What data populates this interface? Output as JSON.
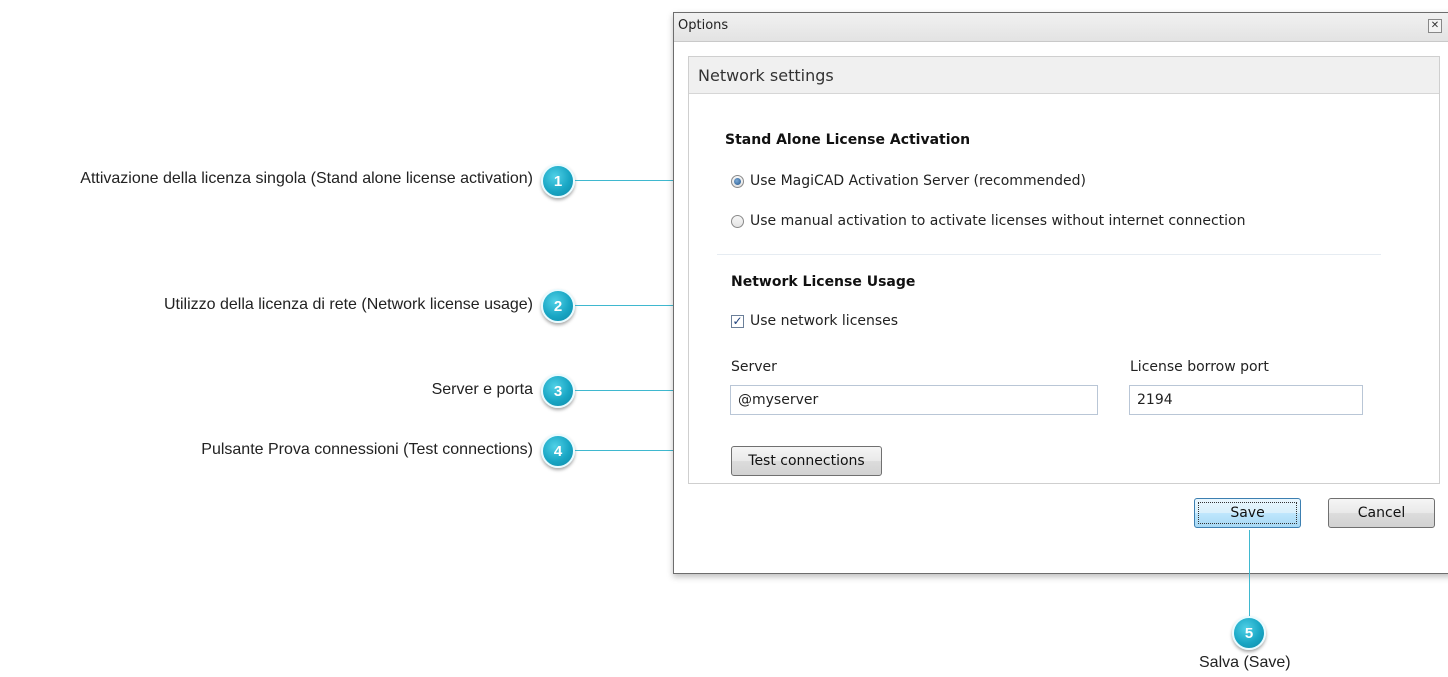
{
  "callouts": [
    {
      "number": "1",
      "text": "Attivazione della licenza singola (Stand alone license activation)"
    },
    {
      "number": "2",
      "text": "Utilizzo della licenza di rete (Network license usage)"
    },
    {
      "number": "3",
      "text": "Server e porta"
    },
    {
      "number": "4",
      "text": "Pulsante Prova connessioni (Test connections)"
    },
    {
      "number": "5",
      "text": "Salva (Save)"
    }
  ],
  "window": {
    "title": "Options",
    "close_icon": "close-icon"
  },
  "panel": {
    "title": "Network settings"
  },
  "standalone": {
    "heading": "Stand Alone License Activation",
    "option_server": "Use MagiCAD Activation Server (recommended)",
    "option_manual": "Use manual activation to activate licenses without internet connection",
    "selected": "option_server"
  },
  "network": {
    "heading": "Network License Usage",
    "use_network_label": "Use network licenses",
    "use_network_checked": true,
    "server_label": "Server",
    "server_value": "@myserver",
    "port_label": "License borrow port",
    "port_value": "2194",
    "test_button": "Test connections"
  },
  "footer": {
    "save": "Save",
    "cancel": "Cancel"
  },
  "colors": {
    "badge": "#19a6c4",
    "leader": "#3fb8cf"
  }
}
